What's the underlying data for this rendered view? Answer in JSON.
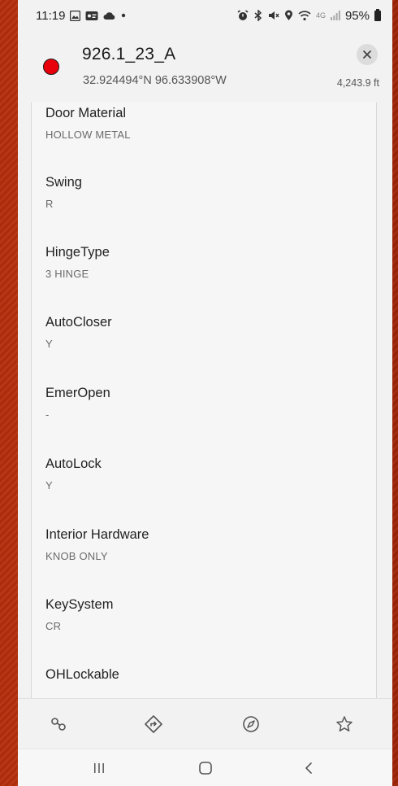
{
  "status_bar": {
    "time": "11:19",
    "network_label": "4G",
    "battery_percent": "95%"
  },
  "feature": {
    "title": "926.1_23_A",
    "coordinates": "32.924494°N 96.633908°W",
    "distance": "4,243.9 ft",
    "status_color": "#e8000b"
  },
  "attributes": [
    {
      "label": "Door Material",
      "value": "HOLLOW METAL"
    },
    {
      "label": "Swing",
      "value": "R"
    },
    {
      "label": "HingeType",
      "value": "3 HINGE"
    },
    {
      "label": "AutoCloser",
      "value": "Y"
    },
    {
      "label": "EmerOpen",
      "value": "-"
    },
    {
      "label": "AutoLock",
      "value": "Y"
    },
    {
      "label": "Interior Hardware",
      "value": "KNOB ONLY"
    },
    {
      "label": "KeySystem",
      "value": "CR"
    },
    {
      "label": "OHLockable",
      "value": ""
    }
  ],
  "toolbar": {
    "icons": [
      "link-icon",
      "directions-icon",
      "compass-icon",
      "star-icon"
    ]
  },
  "nav": {
    "icons": [
      "recent-apps-icon",
      "home-icon",
      "back-icon"
    ]
  }
}
